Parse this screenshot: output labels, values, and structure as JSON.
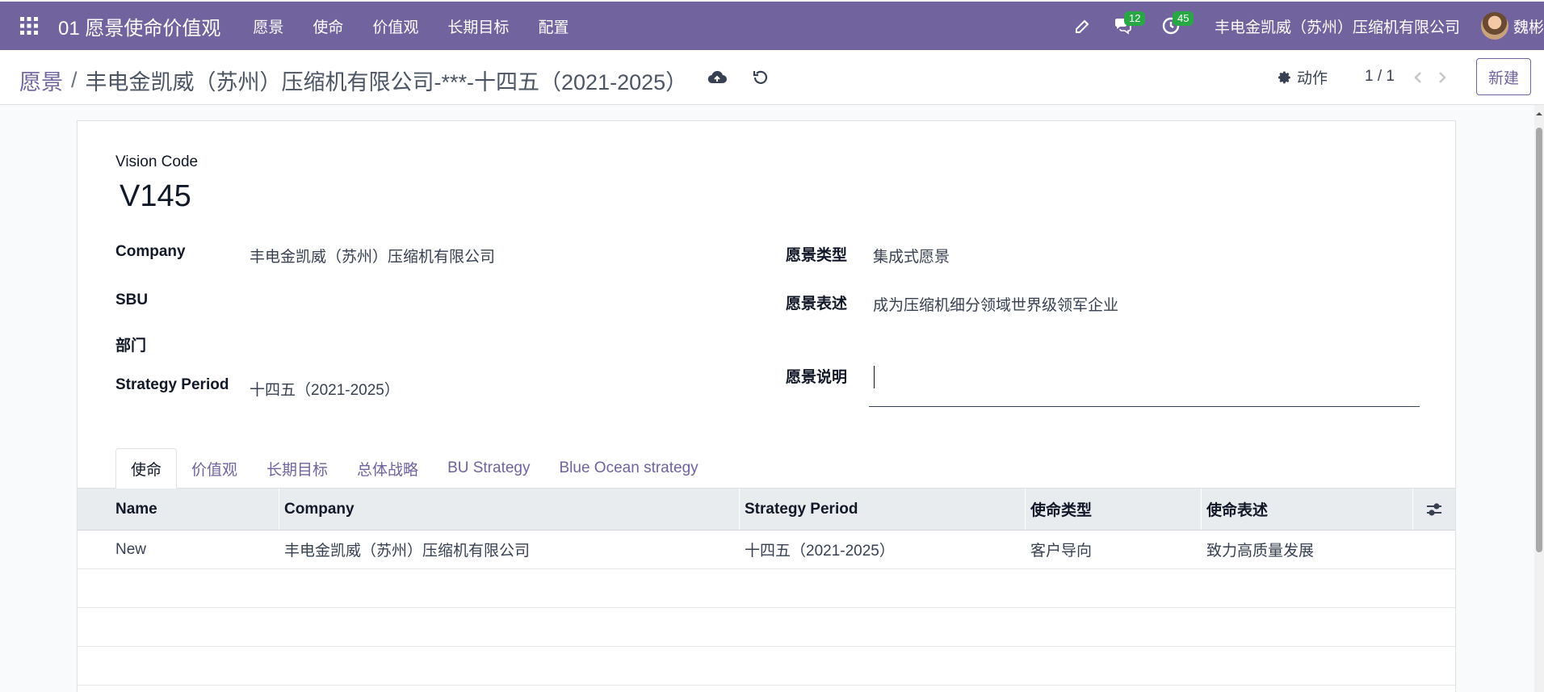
{
  "topbar": {
    "app_title": "01 愿景使命价值观",
    "menu": [
      "愿景",
      "使命",
      "价值观",
      "长期目标",
      "配置"
    ],
    "messages_count": "12",
    "activities_count": "45",
    "company": "丰电金凯威（苏州）压缩机有限公司",
    "user": "魏彬"
  },
  "control": {
    "breadcrumb_parent": "愿景",
    "breadcrumb_sep": "/",
    "breadcrumb_current": "丰电金凯威（苏州）压缩机有限公司-***-十四五（2021-2025）",
    "action_label": "动作",
    "pager": "1 / 1",
    "new_label": "新建"
  },
  "form": {
    "code_label": "Vision Code",
    "code_value": "V145",
    "company_label": "Company",
    "company_value": "丰电金凯威（苏州）压缩机有限公司",
    "sbu_label": "SBU",
    "dept_label": "部门",
    "period_label": "Strategy Period",
    "period_value": "十四五（2021-2025）",
    "type_label": "愿景类型",
    "type_value": "集成式愿景",
    "statement_label": "愿景表述",
    "statement_value": "成为压缩机细分领域世界级领军企业",
    "desc_label": "愿景说明"
  },
  "tabs": [
    "使命",
    "价值观",
    "长期目标",
    "总体战略",
    "BU Strategy",
    "Blue Ocean strategy"
  ],
  "table": {
    "headers": [
      "Name",
      "Company",
      "Strategy Period",
      "使命类型",
      "使命表述"
    ],
    "rows": [
      [
        "New",
        "丰电金凯威（苏州）压缩机有限公司",
        "十四五（2021-2025）",
        "客户导向",
        "致力高质量发展"
      ]
    ]
  },
  "colors": {
    "brand": "#71639e",
    "badge": "#28a745"
  }
}
